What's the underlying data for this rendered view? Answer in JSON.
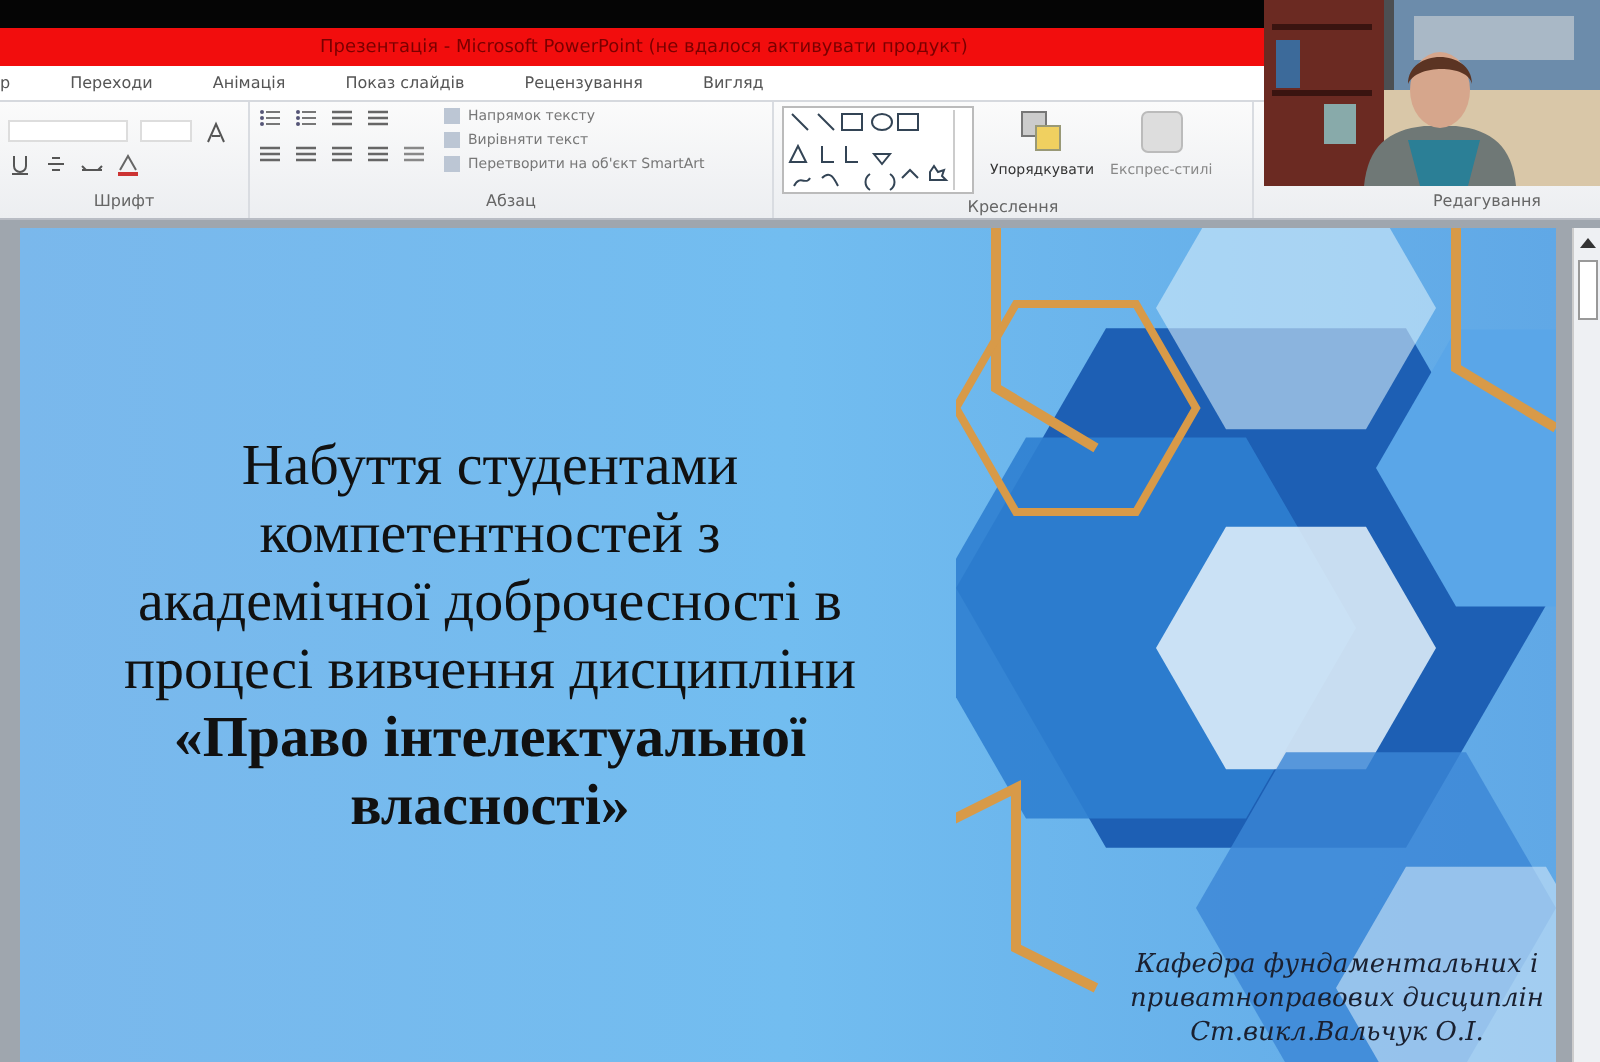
{
  "window": {
    "title": "Презентація - Microsoft PowerPoint (не вдалося активувати продукт)"
  },
  "tabs": [
    {
      "label": "р",
      "selected": false
    },
    {
      "label": "Переходи",
      "selected": false
    },
    {
      "label": "Анімація",
      "selected": false
    },
    {
      "label": "Показ слайдів",
      "selected": false
    },
    {
      "label": "Рецензування",
      "selected": false
    },
    {
      "label": "Вигляд",
      "selected": false
    }
  ],
  "ribbon": {
    "groups": [
      {
        "kind": "font",
        "label": "Шрифт"
      },
      {
        "kind": "paragraph",
        "label": "Абзац",
        "commands": [
          "Напрямок тексту",
          "Вирівняти текст",
          "Перетворити на об'єкт SmartArt"
        ]
      },
      {
        "kind": "drawing",
        "label": "Креслення",
        "commands": [
          "Упорядкувати",
          "Експрес-стилі"
        ]
      },
      {
        "kind": "editing",
        "label": "Редагування"
      }
    ]
  },
  "slide": {
    "title_lines": [
      {
        "text": "Набуття студентами",
        "bold": false
      },
      {
        "text": "компетентностей з",
        "bold": false
      },
      {
        "text": "академічної доброчесності в",
        "bold": false
      },
      {
        "text": "процесі вивчення дисципліни",
        "bold": false
      },
      {
        "text": "«Право інтелектуальної",
        "bold": true
      },
      {
        "text": "власності»",
        "bold": true
      }
    ],
    "signature_lines": [
      "Кафедра фундаментальних і",
      "приватноправових дисциплін",
      "Ст.викл.Вальчук О.І."
    ]
  }
}
